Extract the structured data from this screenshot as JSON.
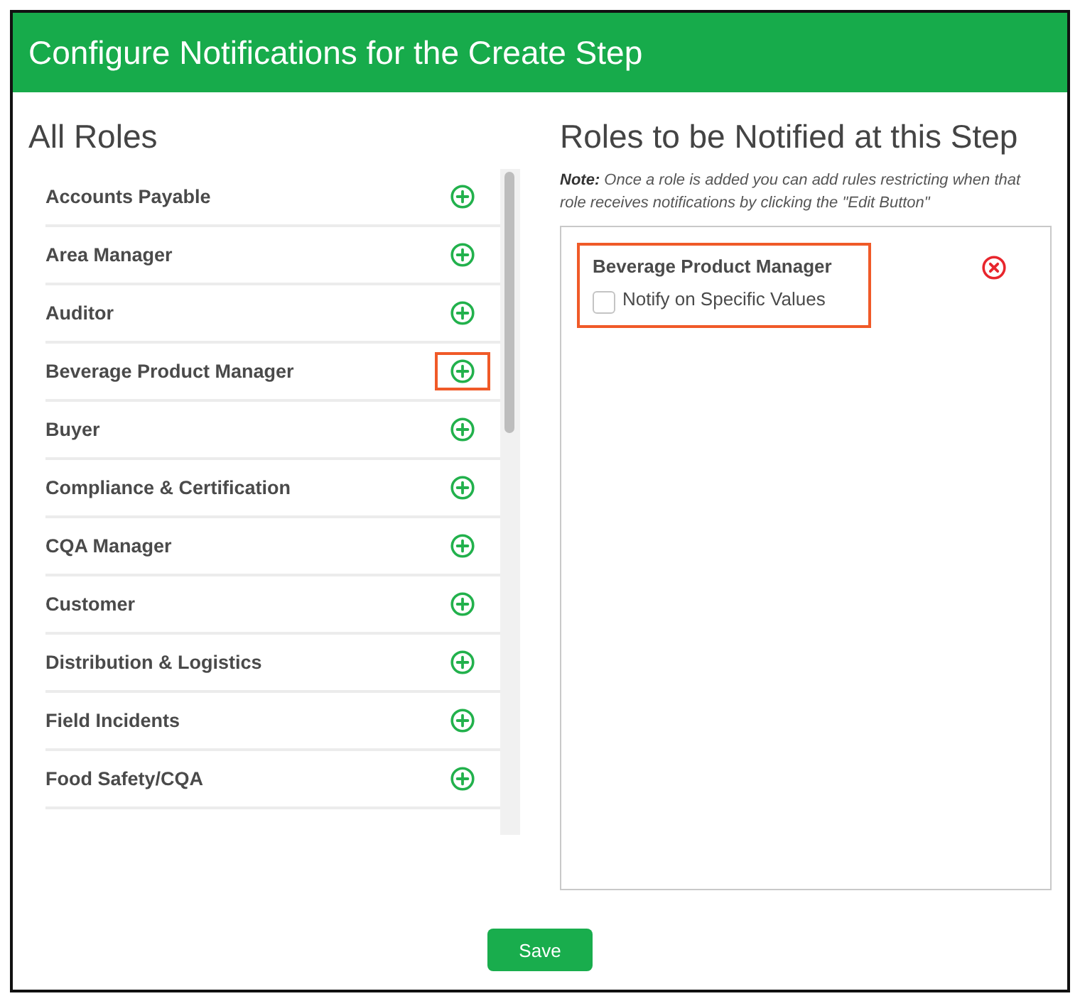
{
  "header": {
    "title": "Configure Notifications for the Create Step"
  },
  "all_roles": {
    "heading": "All Roles",
    "roles": [
      {
        "name": "Accounts Payable",
        "highlighted": false
      },
      {
        "name": "Area Manager",
        "highlighted": false
      },
      {
        "name": "Auditor",
        "highlighted": false
      },
      {
        "name": "Beverage Product Manager",
        "highlighted": true
      },
      {
        "name": "Buyer",
        "highlighted": false
      },
      {
        "name": "Compliance & Certification",
        "highlighted": false
      },
      {
        "name": "CQA Manager",
        "highlighted": false
      },
      {
        "name": "Customer",
        "highlighted": false
      },
      {
        "name": "Distribution & Logistics",
        "highlighted": false
      },
      {
        "name": "Field Incidents",
        "highlighted": false
      },
      {
        "name": "Food Safety/CQA",
        "highlighted": false
      }
    ]
  },
  "notified": {
    "heading": "Roles to be Notified at this Step",
    "note": "**Note:** Once a role is added you can add rules restricting when that role receives notifications by clicking the \"Edit Button\"",
    "roles": [
      {
        "name": "Beverage Product Manager",
        "highlighted": true,
        "option": {
          "label": "Notify on Specific Values",
          "checked": false
        }
      }
    ]
  },
  "save_button": {
    "label": "Save"
  }
}
